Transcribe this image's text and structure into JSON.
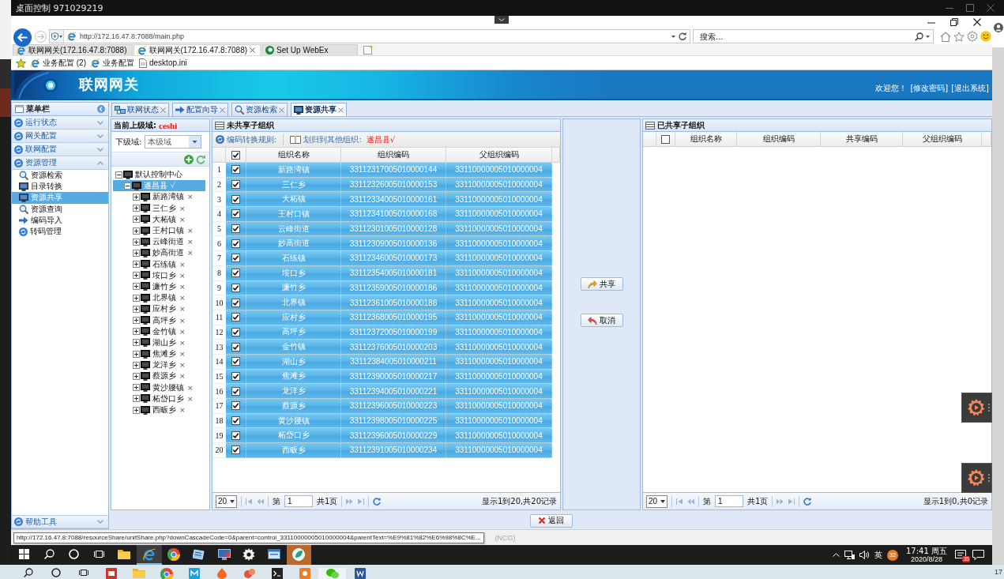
{
  "remote_window": {
    "title": "桌面控制 971029219"
  },
  "browser": {
    "address": "http://172.16.47.8:7088/main.php",
    "search_placeholder": "搜索...",
    "tabs": [
      {
        "label": "联网网关(172.16.47.8:7088)",
        "selected": false
      },
      {
        "label": "联网网关(172.16.47.8:7088)",
        "selected": true
      },
      {
        "label": "Set Up WebEx",
        "selected": false
      }
    ],
    "favorites": [
      {
        "label": "业务配置 (2)",
        "kind": "page"
      },
      {
        "label": "业务配置",
        "kind": "page"
      },
      {
        "label": "desktop.ini",
        "kind": "file"
      }
    ]
  },
  "banner": {
    "title": "联网网关",
    "greeting": "欢迎您！",
    "links": [
      "[修改密码]",
      "[退出系统]"
    ]
  },
  "sidebar": {
    "title": "菜单栏",
    "sections": [
      {
        "label": "运行状态",
        "expanded": false
      },
      {
        "label": "网关配置",
        "expanded": false
      },
      {
        "label": "联网配置",
        "expanded": false
      },
      {
        "label": "资源管理",
        "expanded": true,
        "items": [
          {
            "label": "资源检索",
            "kind": "search",
            "selected": false
          },
          {
            "label": "目录转换",
            "kind": "monitor",
            "selected": false
          },
          {
            "label": "资源共享",
            "kind": "monitor",
            "selected": true
          },
          {
            "label": "资源查询",
            "kind": "search",
            "selected": false
          },
          {
            "label": "编码导入",
            "kind": "import",
            "selected": false
          },
          {
            "label": "转码管理",
            "kind": "cycle",
            "selected": false
          }
        ]
      }
    ],
    "footer": {
      "label": "帮助工具",
      "expanded": false
    }
  },
  "main_tabs": [
    {
      "label": "联网状态",
      "kind": "network",
      "selected": false
    },
    {
      "label": "配置向导",
      "kind": "wizard",
      "selected": false
    },
    {
      "label": "资源检索",
      "kind": "search",
      "selected": false
    },
    {
      "label": "资源共享",
      "kind": "monitor",
      "selected": true
    }
  ],
  "domain_panel": {
    "current_label": "当前上级域:",
    "current_value": "ceshi",
    "sub_label": "下级域:",
    "sub_value": "本级域",
    "tree": [
      {
        "label": "默认控制中心",
        "expanded": true,
        "selected": false,
        "children": [
          {
            "label": "遂昌县",
            "suffix": "√",
            "expanded": true,
            "selected": true,
            "children": [
              {
                "label": "新路湾镇",
                "suffix": "×",
                "expanded": false,
                "selected": false
              },
              {
                "label": "三仁乡",
                "suffix": "×",
                "expanded": false,
                "selected": false
              },
              {
                "label": "大柘镇",
                "suffix": "×",
                "expanded": false,
                "selected": false
              },
              {
                "label": "王村口镇",
                "suffix": "×",
                "expanded": false,
                "selected": false
              },
              {
                "label": "云峰街道",
                "suffix": "×",
                "expanded": false,
                "selected": false
              },
              {
                "label": "妙高街道",
                "suffix": "×",
                "expanded": false,
                "selected": false
              },
              {
                "label": "石练镇",
                "suffix": "×",
                "expanded": false,
                "selected": false
              },
              {
                "label": "垵口乡",
                "suffix": "×",
                "expanded": false,
                "selected": false
              },
              {
                "label": "濂竹乡",
                "suffix": "×",
                "expanded": false,
                "selected": false
              },
              {
                "label": "北界镇",
                "suffix": "×",
                "expanded": false,
                "selected": false
              },
              {
                "label": "应村乡",
                "suffix": "×",
                "expanded": false,
                "selected": false
              },
              {
                "label": "高坪乡",
                "suffix": "×",
                "expanded": false,
                "selected": false
              },
              {
                "label": "金竹镇",
                "suffix": "×",
                "expanded": false,
                "selected": false
              },
              {
                "label": "湖山乡",
                "suffix": "×",
                "expanded": false,
                "selected": false
              },
              {
                "label": "焦滩乡",
                "suffix": "×",
                "expanded": false,
                "selected": false
              },
              {
                "label": "龙洋乡",
                "suffix": "×",
                "expanded": false,
                "selected": false
              },
              {
                "label": "蔡源乡",
                "suffix": "×",
                "expanded": false,
                "selected": false
              },
              {
                "label": "黄沙腰镇",
                "suffix": "×",
                "expanded": false,
                "selected": false
              },
              {
                "label": "柘岱口乡",
                "suffix": "×",
                "expanded": false,
                "selected": false
              },
              {
                "label": "西畈乡",
                "suffix": "×",
                "expanded": false,
                "selected": false
              }
            ]
          }
        ]
      }
    ]
  },
  "unshared_panel": {
    "title": "未共享子组织",
    "toolbar": [
      {
        "label": "编码转换规则:",
        "kind": "rule"
      },
      {
        "label": "划归到其他组织:",
        "kind": "assign",
        "value": "遂昌县√"
      }
    ],
    "table": {
      "columns": [
        "组织名称",
        "组织编码",
        "父组织编码"
      ],
      "all_checked": true,
      "rows": [
        {
          "index": "1",
          "checked": true,
          "selected": true,
          "name": "新路湾镇",
          "code": "33112317005010000144",
          "parent_code": "33110000005010000004"
        },
        {
          "index": "2",
          "checked": true,
          "selected": true,
          "name": "三仁乡",
          "code": "33112326005010000153",
          "parent_code": "33110000005010000004"
        },
        {
          "index": "3",
          "checked": true,
          "selected": true,
          "name": "大柘镇",
          "code": "33112334005010000161",
          "parent_code": "33110000005010000004"
        },
        {
          "index": "4",
          "checked": true,
          "selected": true,
          "name": "王村口镇",
          "code": "33112341005010000168",
          "parent_code": "33110000005010000004"
        },
        {
          "index": "5",
          "checked": true,
          "selected": true,
          "name": "云峰街道",
          "code": "33112301005010000128",
          "parent_code": "33110000005010000004"
        },
        {
          "index": "6",
          "checked": true,
          "selected": true,
          "name": "妙高街道",
          "code": "33112309005010000136",
          "parent_code": "33110000005010000004"
        },
        {
          "index": "7",
          "checked": true,
          "selected": true,
          "name": "石练镇",
          "code": "33112346005010000173",
          "parent_code": "33110000005010000004"
        },
        {
          "index": "8",
          "checked": true,
          "selected": true,
          "name": "垵口乡",
          "code": "33112354005010000181",
          "parent_code": "33110000005010000004"
        },
        {
          "index": "9",
          "checked": true,
          "selected": true,
          "name": "濂竹乡",
          "code": "33112359005010000186",
          "parent_code": "33110000005010000004"
        },
        {
          "index": "10",
          "checked": true,
          "selected": true,
          "name": "北界镇",
          "code": "33112361005010000188",
          "parent_code": "33110000005010000004"
        },
        {
          "index": "11",
          "checked": true,
          "selected": true,
          "name": "应村乡",
          "code": "33112368005010000195",
          "parent_code": "33110000005010000004"
        },
        {
          "index": "12",
          "checked": true,
          "selected": true,
          "name": "高坪乡",
          "code": "33112372005010000199",
          "parent_code": "33110000005010000004"
        },
        {
          "index": "13",
          "checked": true,
          "selected": true,
          "name": "金竹镇",
          "code": "33112376005010000203",
          "parent_code": "33110000005010000004"
        },
        {
          "index": "14",
          "checked": true,
          "selected": true,
          "name": "湖山乡",
          "code": "33112384005010000211",
          "parent_code": "33110000005010000004"
        },
        {
          "index": "15",
          "checked": true,
          "selected": true,
          "name": "焦滩乡",
          "code": "33112390005010000217",
          "parent_code": "33110000005010000004"
        },
        {
          "index": "16",
          "checked": true,
          "selected": true,
          "name": "龙洋乡",
          "code": "33112394005010000221",
          "parent_code": "33110000005010000004"
        },
        {
          "index": "17",
          "checked": true,
          "selected": true,
          "name": "蔡源乡",
          "code": "33112396005010000223",
          "parent_code": "33110000005010000004"
        },
        {
          "index": "18",
          "checked": true,
          "selected": true,
          "name": "黄沙腰镇",
          "code": "33112398005010000225",
          "parent_code": "33110000005010000004"
        },
        {
          "index": "19",
          "checked": true,
          "selected": true,
          "name": "柘岱口乡",
          "code": "33112396005010000229",
          "parent_code": "33110000005010000004"
        },
        {
          "index": "20",
          "checked": true,
          "selected": true,
          "name": "西畈乡",
          "code": "33112391005010000234",
          "parent_code": "33110000005010000004"
        }
      ]
    },
    "pager": {
      "page_size": "20",
      "page_label": "第",
      "page": "1",
      "total_pages": "共1页",
      "summary": "显示1到20,共20记录"
    }
  },
  "actions": [
    {
      "label": "共享",
      "kind": "share"
    },
    {
      "label": "取消",
      "kind": "cancel"
    }
  ],
  "shared_panel": {
    "title": "已共享子组织",
    "table": {
      "columns": [
        "组织名称",
        "组织编码",
        "共享编码",
        "父组织编码"
      ],
      "all_checked": false
    },
    "pager": {
      "page_size": "20",
      "page_label": "第",
      "page": "1",
      "total_pages": "共1页",
      "summary": "显示1到0,共0记录"
    }
  },
  "back_button": "返回",
  "status_bar": {
    "url_tooltip": "http://172.16.47.8:7088/resourceShare/unitShare.php?downCascadeCode=0&parent=control_33110000005010000004&parentText=%E9%81%82%E6%98%8C%E...",
    "text": "(NCG)"
  },
  "taskbar": {
    "apps": [
      {
        "kind": "folder",
        "active": false,
        "attention": false
      },
      {
        "kind": "ie",
        "active": true,
        "attention": false
      },
      {
        "kind": "wheel",
        "active": false,
        "attention": false
      },
      {
        "kind": "notebook",
        "active": false,
        "attention": false
      },
      {
        "kind": "monitor",
        "active": false,
        "attention": false
      },
      {
        "kind": "gear",
        "active": false,
        "attention": false
      },
      {
        "kind": "window",
        "active": false,
        "attention": false
      },
      {
        "kind": "leaf",
        "active": false,
        "attention": true
      }
    ],
    "input_method": "英",
    "tray_badge": "32",
    "time": "17:41 周五",
    "date": "2020/8/28",
    "notification_count": "35"
  },
  "local_taskbar": {
    "apps": [
      {
        "kind": "tile",
        "active": false
      },
      {
        "kind": "folder",
        "active": false
      },
      {
        "kind": "wheel",
        "active": false
      },
      {
        "kind": "blue-tile",
        "active": false
      },
      {
        "kind": "flame",
        "active": false
      },
      {
        "kind": "blob",
        "active": false
      },
      {
        "kind": "terminal",
        "active": false
      },
      {
        "kind": "orange-tile",
        "active": false
      },
      {
        "kind": "chat",
        "active": true
      },
      {
        "kind": "document",
        "active": false
      }
    ],
    "clock_fragment": "17"
  }
}
